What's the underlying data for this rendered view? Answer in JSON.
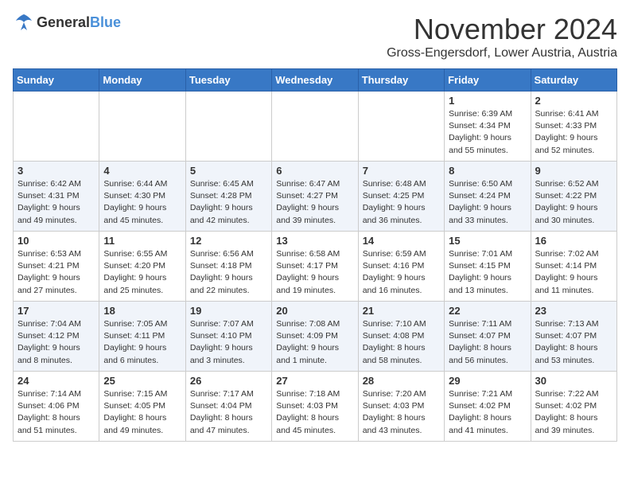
{
  "logo": {
    "general": "General",
    "blue": "Blue"
  },
  "title": "November 2024",
  "location": "Gross-Engersdorf, Lower Austria, Austria",
  "weekdays": [
    "Sunday",
    "Monday",
    "Tuesday",
    "Wednesday",
    "Thursday",
    "Friday",
    "Saturday"
  ],
  "weeks": [
    [
      {
        "day": "",
        "sunrise": "",
        "sunset": "",
        "daylight": ""
      },
      {
        "day": "",
        "sunrise": "",
        "sunset": "",
        "daylight": ""
      },
      {
        "day": "",
        "sunrise": "",
        "sunset": "",
        "daylight": ""
      },
      {
        "day": "",
        "sunrise": "",
        "sunset": "",
        "daylight": ""
      },
      {
        "day": "",
        "sunrise": "",
        "sunset": "",
        "daylight": ""
      },
      {
        "day": "1",
        "sunrise": "Sunrise: 6:39 AM",
        "sunset": "Sunset: 4:34 PM",
        "daylight": "Daylight: 9 hours and 55 minutes."
      },
      {
        "day": "2",
        "sunrise": "Sunrise: 6:41 AM",
        "sunset": "Sunset: 4:33 PM",
        "daylight": "Daylight: 9 hours and 52 minutes."
      }
    ],
    [
      {
        "day": "3",
        "sunrise": "Sunrise: 6:42 AM",
        "sunset": "Sunset: 4:31 PM",
        "daylight": "Daylight: 9 hours and 49 minutes."
      },
      {
        "day": "4",
        "sunrise": "Sunrise: 6:44 AM",
        "sunset": "Sunset: 4:30 PM",
        "daylight": "Daylight: 9 hours and 45 minutes."
      },
      {
        "day": "5",
        "sunrise": "Sunrise: 6:45 AM",
        "sunset": "Sunset: 4:28 PM",
        "daylight": "Daylight: 9 hours and 42 minutes."
      },
      {
        "day": "6",
        "sunrise": "Sunrise: 6:47 AM",
        "sunset": "Sunset: 4:27 PM",
        "daylight": "Daylight: 9 hours and 39 minutes."
      },
      {
        "day": "7",
        "sunrise": "Sunrise: 6:48 AM",
        "sunset": "Sunset: 4:25 PM",
        "daylight": "Daylight: 9 hours and 36 minutes."
      },
      {
        "day": "8",
        "sunrise": "Sunrise: 6:50 AM",
        "sunset": "Sunset: 4:24 PM",
        "daylight": "Daylight: 9 hours and 33 minutes."
      },
      {
        "day": "9",
        "sunrise": "Sunrise: 6:52 AM",
        "sunset": "Sunset: 4:22 PM",
        "daylight": "Daylight: 9 hours and 30 minutes."
      }
    ],
    [
      {
        "day": "10",
        "sunrise": "Sunrise: 6:53 AM",
        "sunset": "Sunset: 4:21 PM",
        "daylight": "Daylight: 9 hours and 27 minutes."
      },
      {
        "day": "11",
        "sunrise": "Sunrise: 6:55 AM",
        "sunset": "Sunset: 4:20 PM",
        "daylight": "Daylight: 9 hours and 25 minutes."
      },
      {
        "day": "12",
        "sunrise": "Sunrise: 6:56 AM",
        "sunset": "Sunset: 4:18 PM",
        "daylight": "Daylight: 9 hours and 22 minutes."
      },
      {
        "day": "13",
        "sunrise": "Sunrise: 6:58 AM",
        "sunset": "Sunset: 4:17 PM",
        "daylight": "Daylight: 9 hours and 19 minutes."
      },
      {
        "day": "14",
        "sunrise": "Sunrise: 6:59 AM",
        "sunset": "Sunset: 4:16 PM",
        "daylight": "Daylight: 9 hours and 16 minutes."
      },
      {
        "day": "15",
        "sunrise": "Sunrise: 7:01 AM",
        "sunset": "Sunset: 4:15 PM",
        "daylight": "Daylight: 9 hours and 13 minutes."
      },
      {
        "day": "16",
        "sunrise": "Sunrise: 7:02 AM",
        "sunset": "Sunset: 4:14 PM",
        "daylight": "Daylight: 9 hours and 11 minutes."
      }
    ],
    [
      {
        "day": "17",
        "sunrise": "Sunrise: 7:04 AM",
        "sunset": "Sunset: 4:12 PM",
        "daylight": "Daylight: 9 hours and 8 minutes."
      },
      {
        "day": "18",
        "sunrise": "Sunrise: 7:05 AM",
        "sunset": "Sunset: 4:11 PM",
        "daylight": "Daylight: 9 hours and 6 minutes."
      },
      {
        "day": "19",
        "sunrise": "Sunrise: 7:07 AM",
        "sunset": "Sunset: 4:10 PM",
        "daylight": "Daylight: 9 hours and 3 minutes."
      },
      {
        "day": "20",
        "sunrise": "Sunrise: 7:08 AM",
        "sunset": "Sunset: 4:09 PM",
        "daylight": "Daylight: 9 hours and 1 minute."
      },
      {
        "day": "21",
        "sunrise": "Sunrise: 7:10 AM",
        "sunset": "Sunset: 4:08 PM",
        "daylight": "Daylight: 8 hours and 58 minutes."
      },
      {
        "day": "22",
        "sunrise": "Sunrise: 7:11 AM",
        "sunset": "Sunset: 4:07 PM",
        "daylight": "Daylight: 8 hours and 56 minutes."
      },
      {
        "day": "23",
        "sunrise": "Sunrise: 7:13 AM",
        "sunset": "Sunset: 4:07 PM",
        "daylight": "Daylight: 8 hours and 53 minutes."
      }
    ],
    [
      {
        "day": "24",
        "sunrise": "Sunrise: 7:14 AM",
        "sunset": "Sunset: 4:06 PM",
        "daylight": "Daylight: 8 hours and 51 minutes."
      },
      {
        "day": "25",
        "sunrise": "Sunrise: 7:15 AM",
        "sunset": "Sunset: 4:05 PM",
        "daylight": "Daylight: 8 hours and 49 minutes."
      },
      {
        "day": "26",
        "sunrise": "Sunrise: 7:17 AM",
        "sunset": "Sunset: 4:04 PM",
        "daylight": "Daylight: 8 hours and 47 minutes."
      },
      {
        "day": "27",
        "sunrise": "Sunrise: 7:18 AM",
        "sunset": "Sunset: 4:03 PM",
        "daylight": "Daylight: 8 hours and 45 minutes."
      },
      {
        "day": "28",
        "sunrise": "Sunrise: 7:20 AM",
        "sunset": "Sunset: 4:03 PM",
        "daylight": "Daylight: 8 hours and 43 minutes."
      },
      {
        "day": "29",
        "sunrise": "Sunrise: 7:21 AM",
        "sunset": "Sunset: 4:02 PM",
        "daylight": "Daylight: 8 hours and 41 minutes."
      },
      {
        "day": "30",
        "sunrise": "Sunrise: 7:22 AM",
        "sunset": "Sunset: 4:02 PM",
        "daylight": "Daylight: 8 hours and 39 minutes."
      }
    ]
  ]
}
